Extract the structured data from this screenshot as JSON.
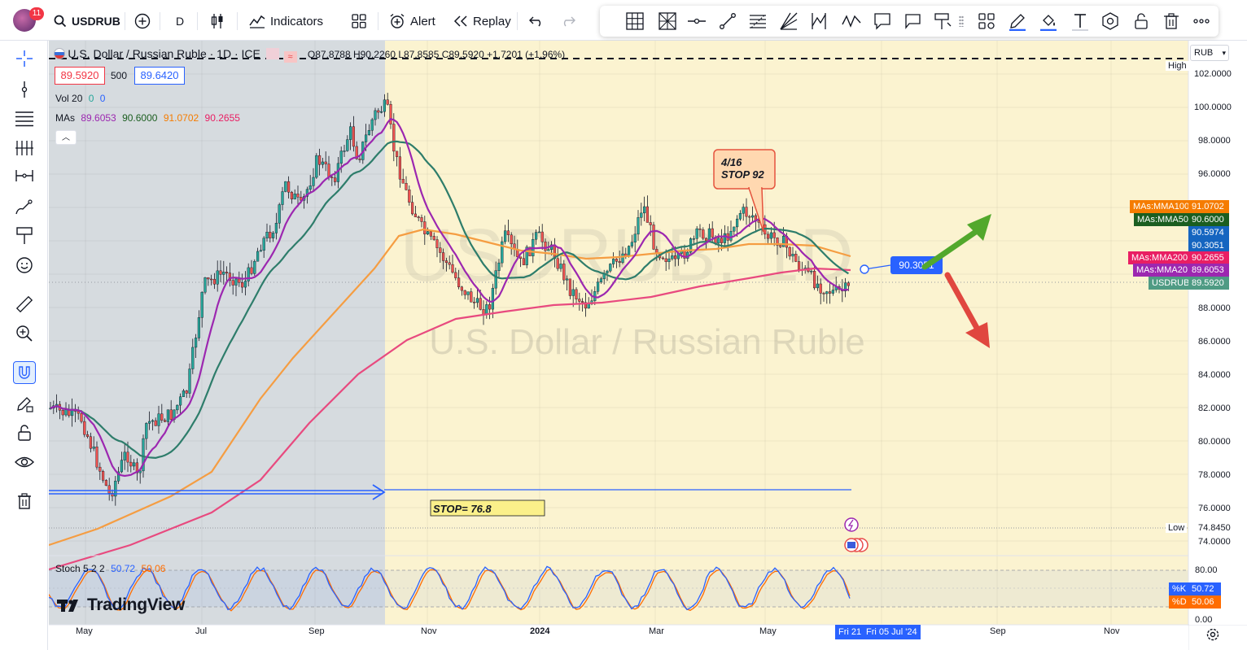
{
  "topbar": {
    "avatar_badge": "11",
    "symbol": "USDRUB",
    "interval": "D",
    "indicators_label": "Indicators",
    "alert_label": "Alert",
    "replay_label": "Replay"
  },
  "legend": {
    "title": "U.S. Dollar / Russian Ruble · 1D · ICE",
    "ohlc": "O87.8788  H90.2260  L87.8585  C89.5920  +1.7201  (+1.96%)",
    "bid": "89.5920",
    "spread": "500",
    "ask": "89.6420",
    "vol_label": "Vol 20",
    "vol_v1": "0",
    "vol_v2": "0",
    "mas_label": "MAs",
    "mas_v1": "89.6053",
    "mas_v2": "90.6000",
    "mas_v3": "91.0702",
    "mas_v4": "90.2655"
  },
  "watermark": {
    "symbol": "USDRUB, 1D",
    "name": "U.S. Dollar / Russian Ruble"
  },
  "annotations": {
    "callout_line1": "4/16",
    "callout_line2": "STOP 92",
    "stop_label": "STOP= 76.8",
    "price_marker": "90.3051"
  },
  "price_axis": {
    "currency": "RUB",
    "high_label": "High",
    "low_label": "Low",
    "low_value": "74.8450",
    "ticks": [
      "102.0000",
      "100.0000",
      "98.0000",
      "96.0000",
      "88.0000",
      "86.0000",
      "84.0000",
      "82.0000",
      "80.0000",
      "78.0000",
      "76.0000",
      "74.0000"
    ],
    "tags": [
      {
        "name": "MAs:MMA100",
        "value": "91.0702",
        "color": "#f57c00"
      },
      {
        "name": "MAs:MMA50",
        "value": "90.6000",
        "color": "#1b5e20"
      },
      {
        "name": "",
        "value": "90.5974",
        "color": "#1565c0"
      },
      {
        "name": "",
        "value": "90.3051",
        "color": "#1565c0"
      },
      {
        "name": "MAs:MMA200",
        "value": "90.2655",
        "color": "#e91e63"
      },
      {
        "name": "MAs:MMA20",
        "value": "89.6053",
        "color": "#9c27b0"
      },
      {
        "name": "USDRUB",
        "value": "89.5920",
        "color": "#26a69a"
      }
    ]
  },
  "stoch": {
    "label": "Stoch 5 2 2",
    "k": "50.72",
    "d": "50.06",
    "k_tag": "%K",
    "d_tag": "%D",
    "ticks": [
      "80.00",
      "0.00"
    ],
    "k_color": "#2962ff",
    "d_color": "#ff6d00"
  },
  "time_axis": {
    "labels": [
      "May",
      "Jul",
      "Sep",
      "Nov",
      "2024",
      "Mar",
      "May",
      "Sep",
      "Nov"
    ],
    "current_short": "Fri 21",
    "current_long": "Fri 05 Jul '24"
  },
  "branding": {
    "logo": "TradingView"
  },
  "colors": {
    "up": "#26a69a",
    "down": "#ef5350",
    "ma20": "#9c27b0",
    "ma50": "#2e7d6b",
    "ma100": "#f59d42",
    "ma200": "#e84a7f",
    "accent": "#2962ff"
  }
}
